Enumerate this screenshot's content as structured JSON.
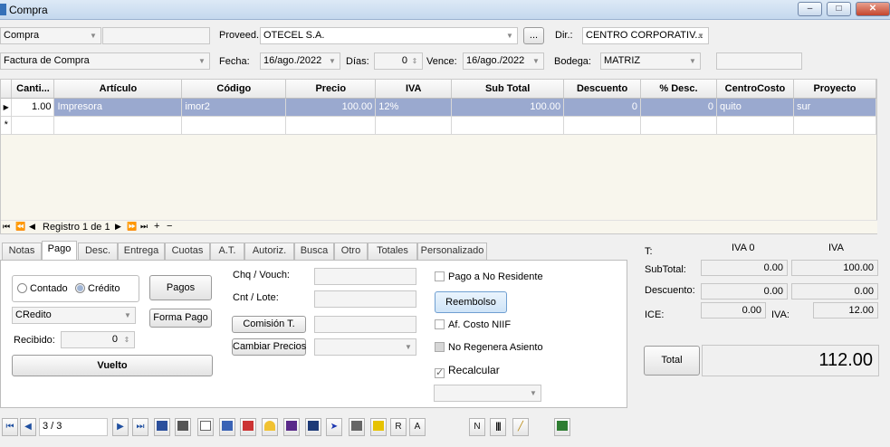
{
  "window": {
    "title": "Compra",
    "min": "–",
    "max": "□",
    "close": "✕"
  },
  "header": {
    "doc_type": "Compra",
    "proveed_label": "Proveed.",
    "proveedor": "OTECEL S.A.",
    "ellipsis": "...",
    "dir_label": "Dir.:",
    "dir": "CENTRO CORPORATIV...",
    "doc_subtype": "Factura de Compra",
    "fecha_label": "Fecha:",
    "fecha": "16/ago./2022",
    "dias_label": "Días:",
    "dias": "0",
    "vence_label": "Vence:",
    "vence": "16/ago./2022",
    "bodega_label": "Bodega:",
    "bodega": "MATRIZ"
  },
  "grid": {
    "columns": [
      "Canti...",
      "Artículo",
      "Código",
      "Precio",
      "IVA",
      "Sub Total",
      "Descuento",
      "% Desc.",
      "CentroCosto",
      "Proyecto"
    ],
    "rows": [
      [
        "1.00",
        "Impresora",
        "imor2",
        "100.00",
        "12%",
        "100.00",
        "0",
        "0",
        "quito",
        "sur"
      ]
    ],
    "new_row_marker": "*",
    "nav_text": "Registro 1 de 1"
  },
  "tabs": [
    "Notas",
    "Pago",
    "Desc.",
    "Entrega",
    "Cuotas",
    "A.T.",
    "Autoriz.",
    "Busca",
    "Otro",
    "Totales",
    "Personalizado"
  ],
  "pago": {
    "contado": "Contado",
    "credito": "Crédito",
    "pagos_btn": "Pagos",
    "forma_pago_btn": "Forma Pago",
    "forma": "CRedito",
    "recibido_label": "Recibido:",
    "recibido": "0",
    "vuelto_btn": "Vuelto",
    "chq_label": "Chq / Vouch:",
    "cnt_label": "Cnt / Lote:",
    "comision_btn": "Comisión T.",
    "cambiar_btn": "Cambiar Precios",
    "pago_no_res": "Pago a No Residente",
    "reembolso_btn": "Reembolso",
    "af_costo": "Af. Costo NIIF",
    "no_regenera": "No Regenera Asiento",
    "recalcular": "Recalcular"
  },
  "totales": {
    "t_label": "T:",
    "iva0_header": "IVA 0",
    "iva_header": "IVA",
    "subtotal_label": "SubTotal:",
    "subtotal_iva0": "0.00",
    "subtotal_iva": "100.00",
    "descuento_label": "Descuento:",
    "descuento_iva0": "0.00",
    "descuento_iva": "0.00",
    "ice_label": "ICE:",
    "ice": "0.00",
    "iva_label": "IVA:",
    "iva": "12.00",
    "total_btn": "Total",
    "total": "112.00"
  },
  "toolbar": {
    "record": "3 / 3",
    "r": "R",
    "a": "A",
    "n": "N"
  }
}
